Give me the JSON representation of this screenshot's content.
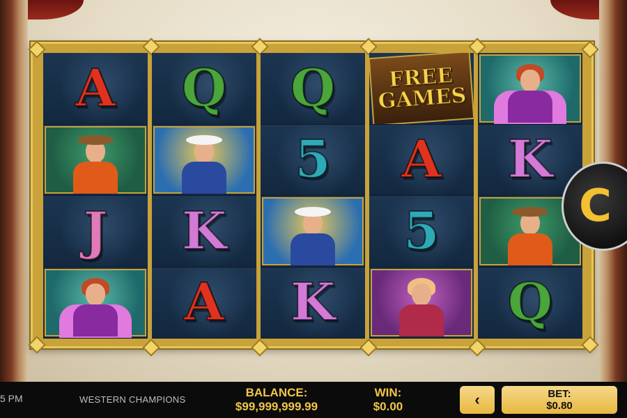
{
  "status_bar": {
    "clock_fragment": "5 PM"
  },
  "game": {
    "name": "WESTERN CHAMPIONS"
  },
  "balance": {
    "label": "BALANCE:",
    "value": "$99,999,999.99"
  },
  "win": {
    "label": "WIN:",
    "value": "$0.00"
  },
  "controls": {
    "prev_icon": "‹",
    "bet_label": "BET:",
    "bet_value": "$0.80",
    "spin_icon": "C"
  },
  "reels": [
    [
      {
        "type": "letter",
        "value": "A"
      },
      {
        "type": "character",
        "value": "cowboy"
      },
      {
        "type": "letter",
        "value": "J"
      },
      {
        "type": "character",
        "value": "dancer"
      }
    ],
    [
      {
        "type": "letter",
        "value": "Q"
      },
      {
        "type": "character",
        "value": "cowgirl"
      },
      {
        "type": "letter",
        "value": "K"
      },
      {
        "type": "letter",
        "value": "A"
      }
    ],
    [
      {
        "type": "letter",
        "value": "Q"
      },
      {
        "type": "letter",
        "value": "5"
      },
      {
        "type": "character",
        "value": "cowgirl"
      },
      {
        "type": "letter",
        "value": "K"
      }
    ],
    [
      {
        "type": "scatter",
        "value": "FREE GAMES"
      },
      {
        "type": "letter",
        "value": "A"
      },
      {
        "type": "letter",
        "value": "5"
      },
      {
        "type": "character",
        "value": "showgirl"
      }
    ],
    [
      {
        "type": "character",
        "value": "dancer"
      },
      {
        "type": "letter",
        "value": "K"
      },
      {
        "type": "character",
        "value": "cowboy"
      },
      {
        "type": "letter",
        "value": "Q"
      }
    ]
  ],
  "scatter_text": {
    "line1": "FREE",
    "line2": "GAMES"
  },
  "colors": {
    "accent_gold": "#f2c54a",
    "reel_bg": "#142436",
    "frame_gold": "#c9a23a"
  }
}
